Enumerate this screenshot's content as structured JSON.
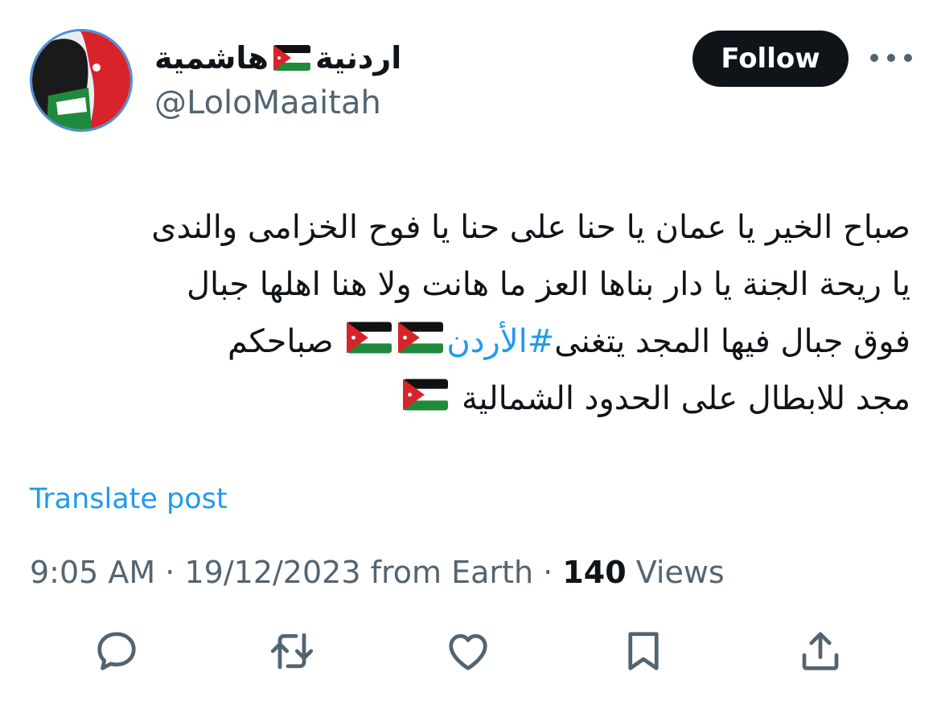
{
  "author": {
    "name_part1": "اردنية",
    "name_part2": "هاشمية",
    "flag_icon": "jordan-flag-emoji",
    "handle": "@LoloMaaitah"
  },
  "follow_button": {
    "label": "Follow"
  },
  "more_icon": "more-dots-icon",
  "tweet": {
    "line1": "صباح الخير يا عمان يا حنا على حنا يا فوح الخزامى والندى",
    "line2": "يا ريحة الجنة يا دار بناها العز ما هانت ولا هنا اهلها جبال",
    "line3_prefix": "فوق جبال فيها المجد يتغنى",
    "line3_hashtag": "#الأردن",
    "line3_suffix": "صباحكم",
    "line4": "مجد للابطال على الحدود الشمالية"
  },
  "translate_link": "Translate post",
  "meta": {
    "time": "9:05 AM",
    "date": "19/12/2023",
    "source": "from Earth",
    "separator": "·",
    "views_count": "140",
    "views_label": "Views"
  },
  "actions": [
    "reply-icon",
    "repost-icon",
    "like-icon",
    "bookmark-icon",
    "share-icon"
  ],
  "colors": {
    "accent": "#1d9bf0",
    "text": "#0f1419",
    "secondary": "#536471",
    "button_bg": "#0f1419"
  }
}
